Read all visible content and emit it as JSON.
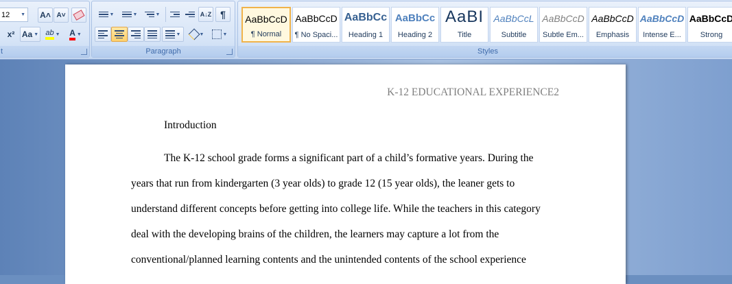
{
  "font": {
    "size_value": "12"
  },
  "groups": {
    "font_label": "t",
    "paragraph_label": "Paragraph",
    "styles_label": "Styles"
  },
  "icons": {
    "grow_font": "A˄",
    "shrink_font": "A˅",
    "superscript": "x²",
    "change_case": "Aa",
    "highlight": "ab",
    "font_color": "A",
    "pilcrow": "¶",
    "sort": "A↓Z"
  },
  "styles": [
    {
      "sample": "AaBbCcD",
      "name": "¶ Normal"
    },
    {
      "sample": "AaBbCcD",
      "name": "¶ No Spaci..."
    },
    {
      "sample": "AaBbCс",
      "name": "Heading 1"
    },
    {
      "sample": "AaBbCc",
      "name": "Heading 2"
    },
    {
      "sample": "AaBI",
      "name": "Title"
    },
    {
      "sample": "AaBbCcL",
      "name": "Subtitle"
    },
    {
      "sample": "AaBbCcD",
      "name": "Subtle Em..."
    },
    {
      "sample": "AaBbCcD",
      "name": "Emphasis"
    },
    {
      "sample": "AaBbCcD",
      "name": "Intense E..."
    },
    {
      "sample": "AaBbCcD",
      "name": "Strong"
    }
  ],
  "document": {
    "header": "K-12 EDUCATIONAL EXPERIENCE2",
    "heading": "Introduction",
    "lines": [
      "The K-12 school grade forms a significant part of a child’s formative years. During the",
      "years that run from kindergarten (3 year olds) to grade 12 (15 year olds), the leaner gets to",
      "understand different concepts before getting into college life. While the teachers in this category",
      "deal with the developing brains of the children, the learners may capture a lot from the",
      "conventional/planned learning contents and the unintended contents of the school experience"
    ]
  },
  "colors": {
    "highlight": "#ffff00",
    "font_color": "#ff0000",
    "selected_style_border": "#f0b34a"
  }
}
